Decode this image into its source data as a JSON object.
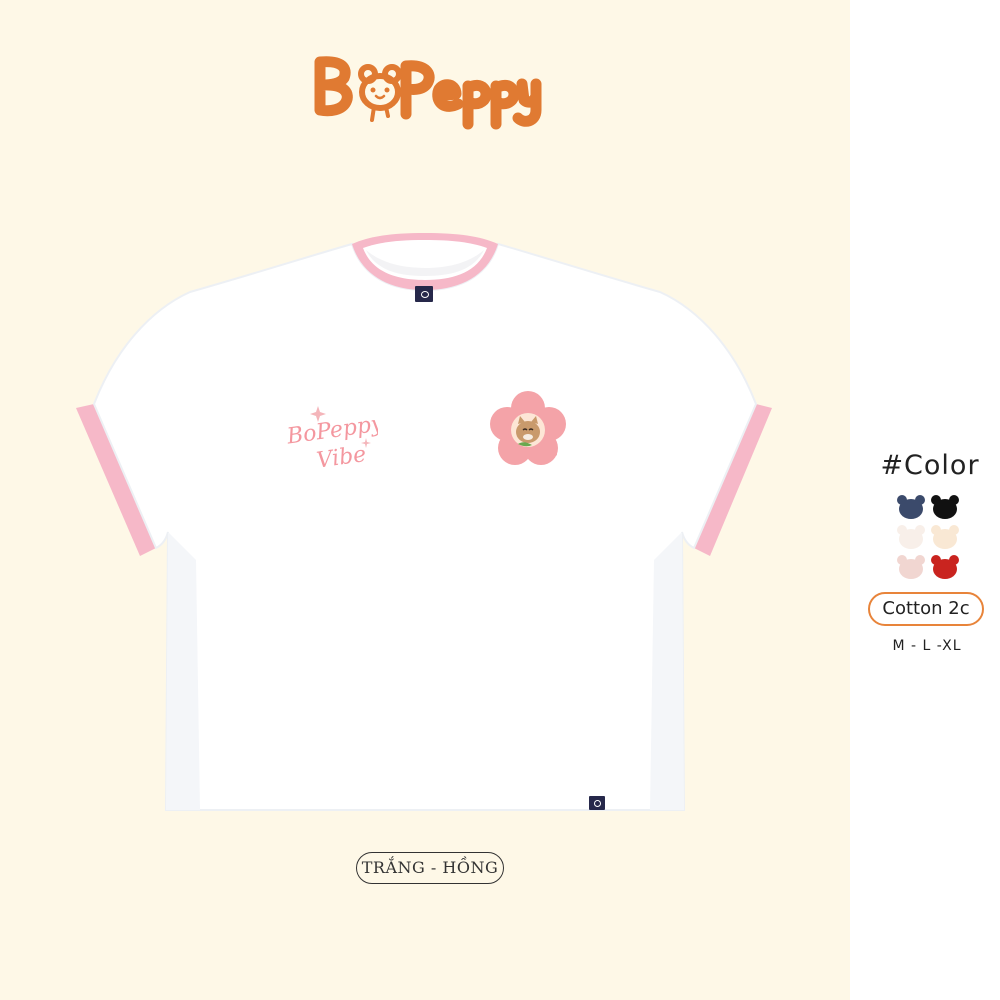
{
  "brand": {
    "name": "BoPeppy",
    "logo_color": "#e07a32",
    "accent_color": "#e8843a"
  },
  "product": {
    "color_name": "TRẮNG - HỒNG",
    "body_color": "#ffffff",
    "trim_color": "#f6b8c8",
    "left_chest_print": "BoPeppy Vibe",
    "print_color": "#f4979f",
    "right_chest_graphic": "flower-cat-icon",
    "label_color": "#26284a"
  },
  "options": {
    "color_heading": "#Color",
    "colors": [
      {
        "name": "navy",
        "hex": "#3b4a6b"
      },
      {
        "name": "black",
        "hex": "#111111"
      },
      {
        "name": "white",
        "hex": "#f8efe9"
      },
      {
        "name": "cream",
        "hex": "#f9e8d4"
      },
      {
        "name": "pink",
        "hex": "#f1d6d1"
      },
      {
        "name": "red",
        "hex": "#c9241f"
      }
    ],
    "material": "Cotton 2c",
    "sizes": "M - L -XL"
  }
}
